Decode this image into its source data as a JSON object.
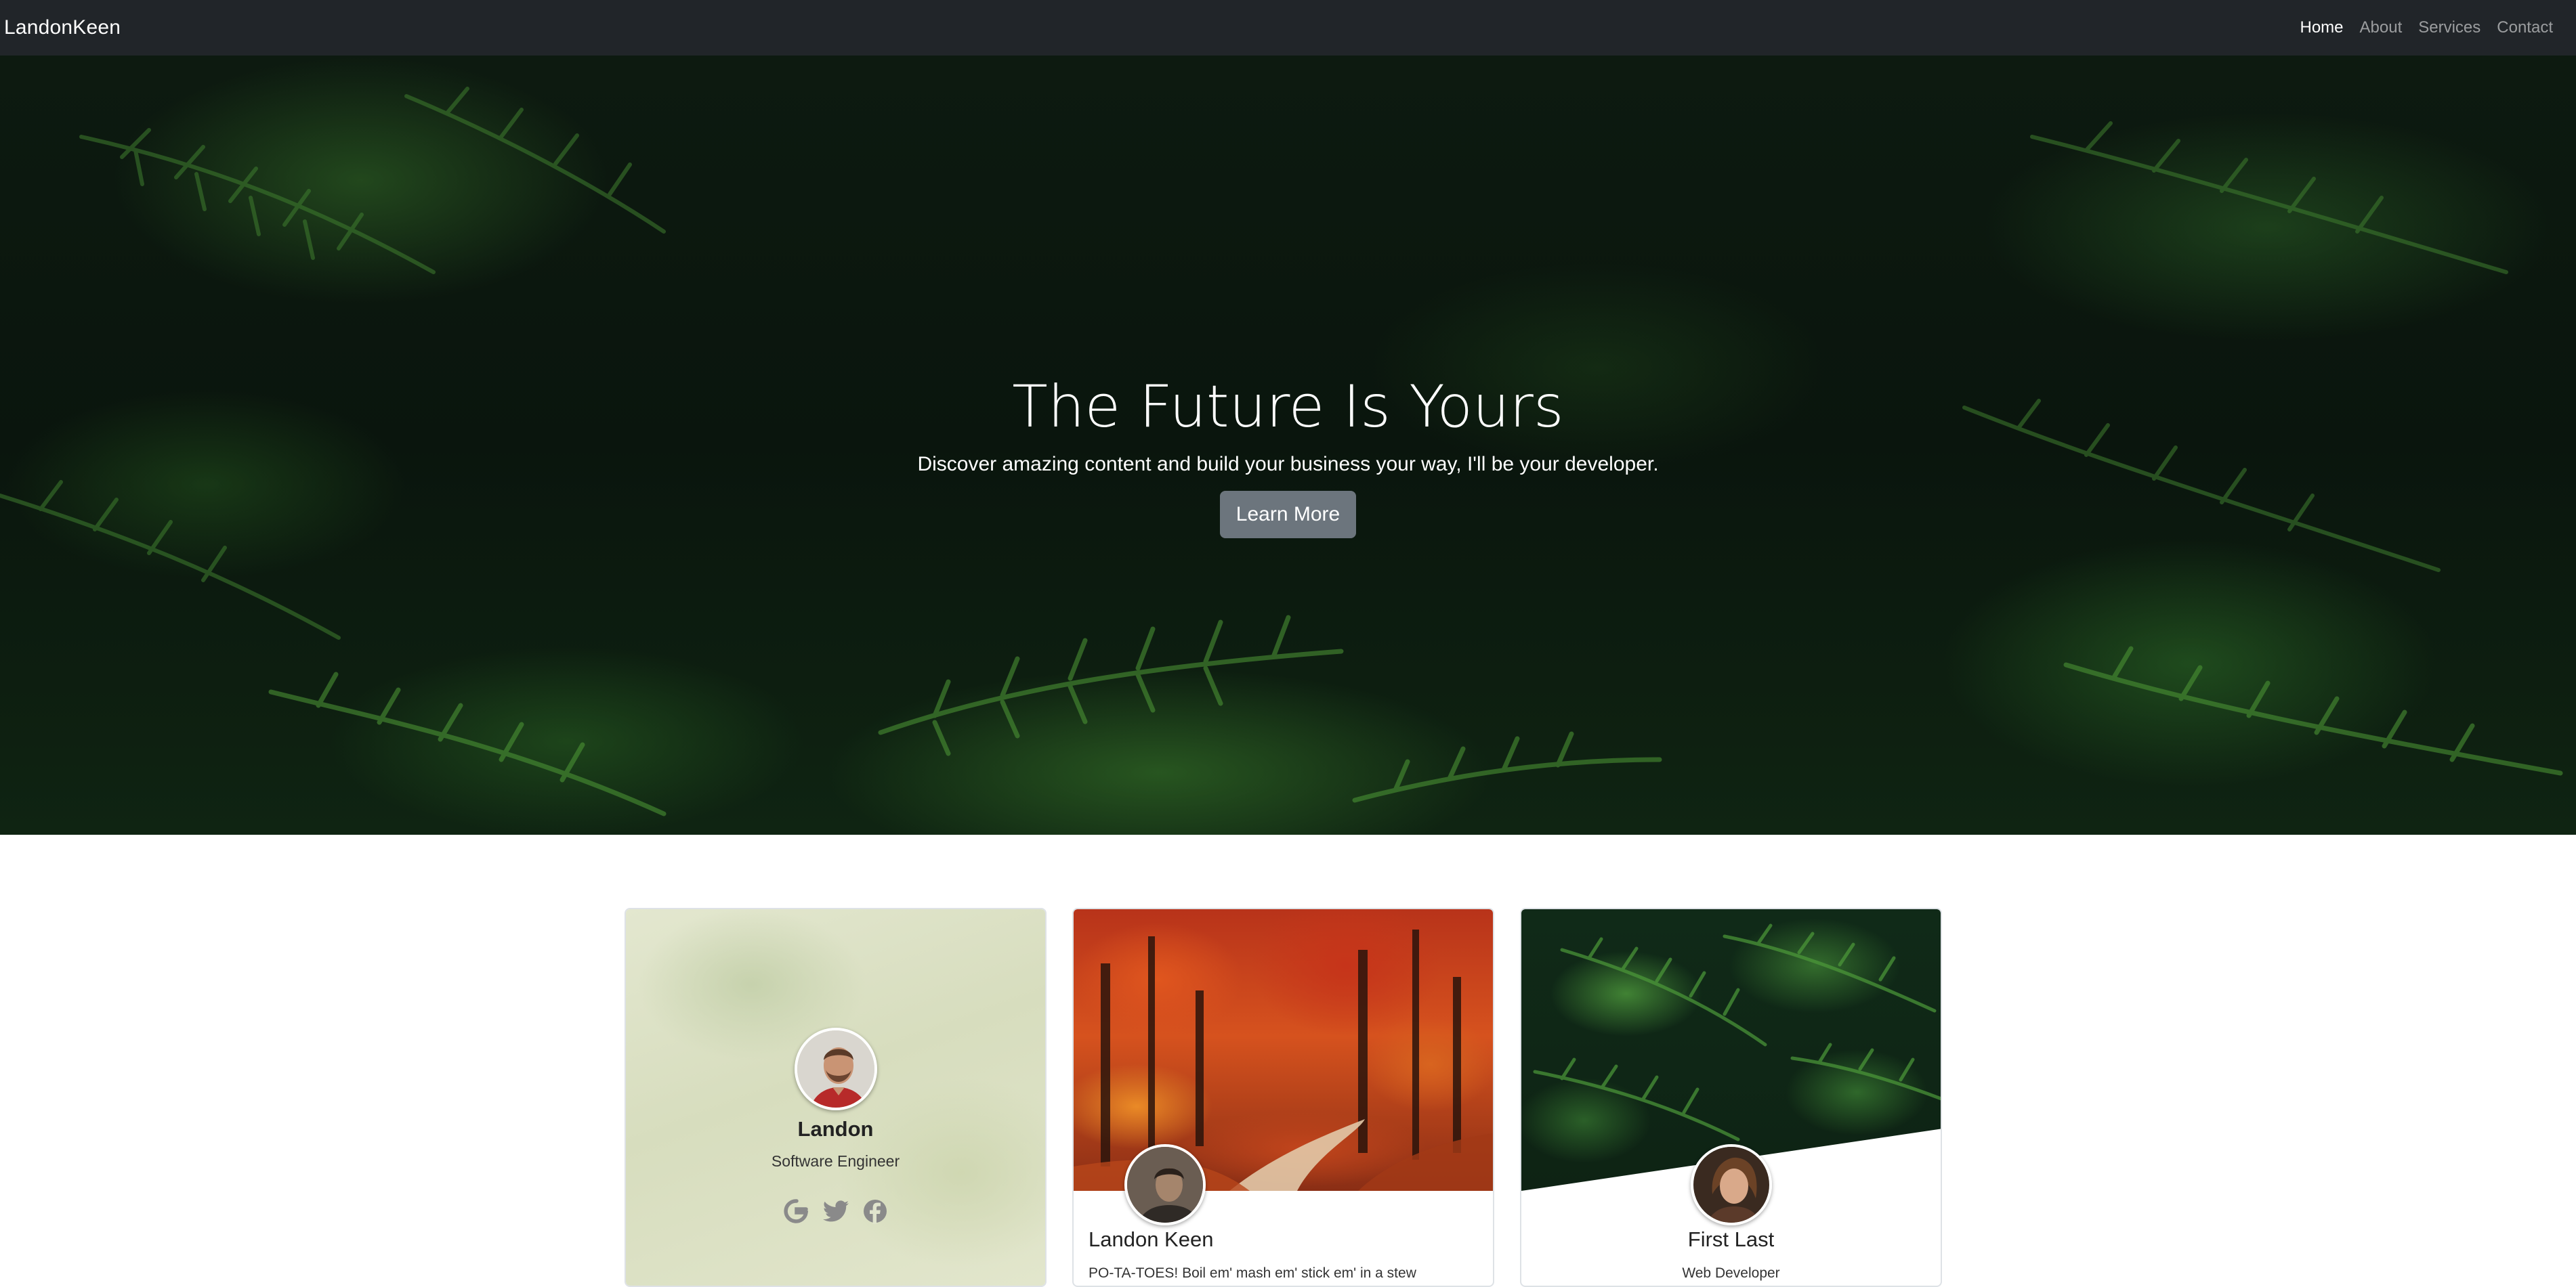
{
  "navbar": {
    "brand": "LandonKeen",
    "links": [
      {
        "label": "Home",
        "active": true
      },
      {
        "label": "About",
        "active": false
      },
      {
        "label": "Services",
        "active": false
      },
      {
        "label": "Contact",
        "active": false
      }
    ]
  },
  "hero": {
    "title": "The Future Is Yours",
    "subtitle": "Discover amazing content and build your business your way, I'll be your developer.",
    "button_label": "Learn More"
  },
  "cards": [
    {
      "name": "Landon",
      "role": "Software Engineer",
      "socials": [
        "google-icon",
        "twitter-icon",
        "facebook-icon"
      ]
    },
    {
      "name": "Landon Keen",
      "description": "PO-TA-TOES! Boil em' mash em' stick em' in a stew"
    },
    {
      "name": "First Last",
      "role": "Web Developer"
    }
  ],
  "colors": {
    "navbar_bg": "#212529",
    "button_bg": "#6c757d",
    "nav_active": "#ffffff",
    "nav_inactive": "rgba(255,255,255,0.55)"
  }
}
